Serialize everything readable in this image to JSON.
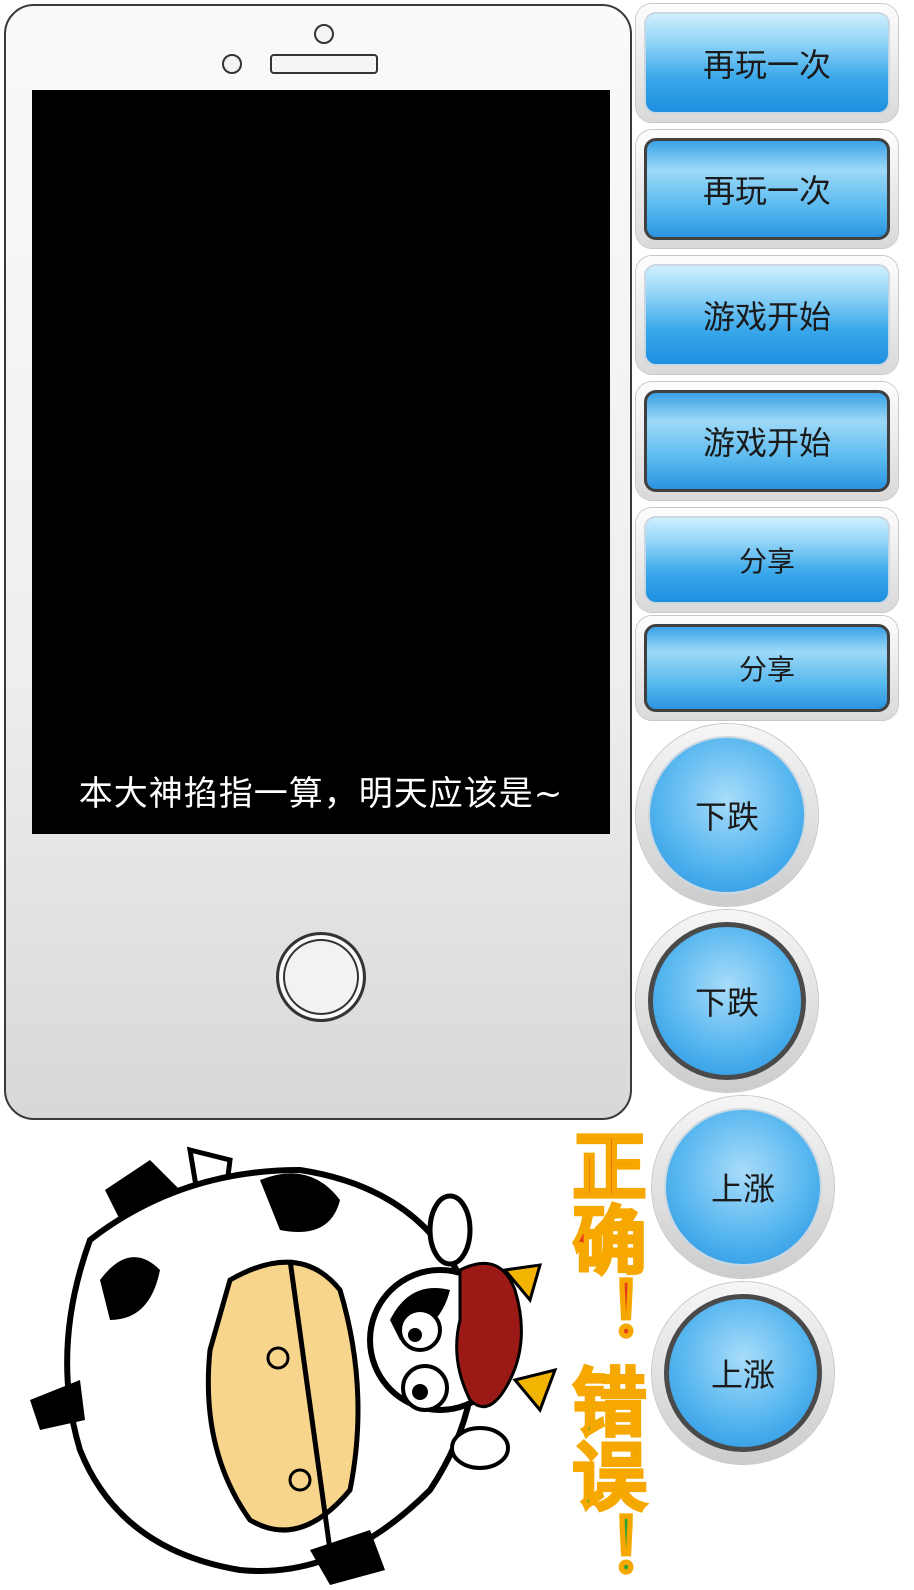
{
  "screen": {
    "message": "本大神掐指一算，明天应该是~"
  },
  "buttons": {
    "replay": "再玩一次",
    "replay_pressed": "再玩一次",
    "start": "游戏开始",
    "start_pressed": "游戏开始",
    "share": "分享",
    "share_pressed": "分享",
    "down": "下跌",
    "down_pressed": "下跌",
    "up": "上涨",
    "up_pressed": "上涨"
  },
  "sign": {
    "correct": "正确！",
    "wrong": "错误！"
  },
  "colors": {
    "button_blue": "#3aa8ea",
    "sign_red": "#e23a1e",
    "sign_green": "#2fa436",
    "sign_outline": "#f6a800"
  }
}
